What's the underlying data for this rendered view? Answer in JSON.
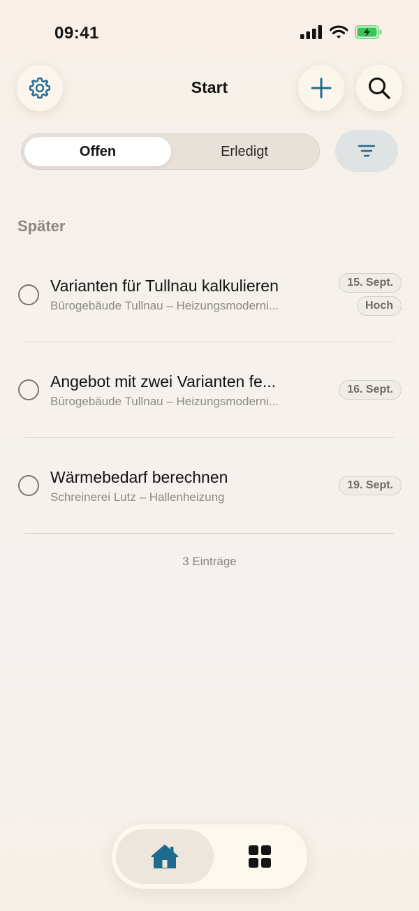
{
  "status_bar": {
    "time": "09:41"
  },
  "header": {
    "title": "Start"
  },
  "segmented": {
    "options": [
      "Offen",
      "Erledigt"
    ],
    "selected": "Offen"
  },
  "section": {
    "title": "Später"
  },
  "tasks": [
    {
      "title": "Varianten für Tullnau kalkulieren",
      "subtitle": "Bürogebäude Tullnau – Heizungsmoderni...",
      "date": "15. Sept.",
      "priority": "Hoch"
    },
    {
      "title": "Angebot mit zwei Varianten fe...",
      "subtitle": "Bürogebäude Tullnau – Heizungsmoderni...",
      "date": "16. Sept."
    },
    {
      "title": "Wärmebedarf berechnen",
      "subtitle": "Schreinerei Lutz – Hallenheizung",
      "date": "19. Sept."
    }
  ],
  "footer": {
    "count": "3 Einträge"
  },
  "colors": {
    "accent": "#1f6b8e",
    "battery": "#34c759"
  }
}
